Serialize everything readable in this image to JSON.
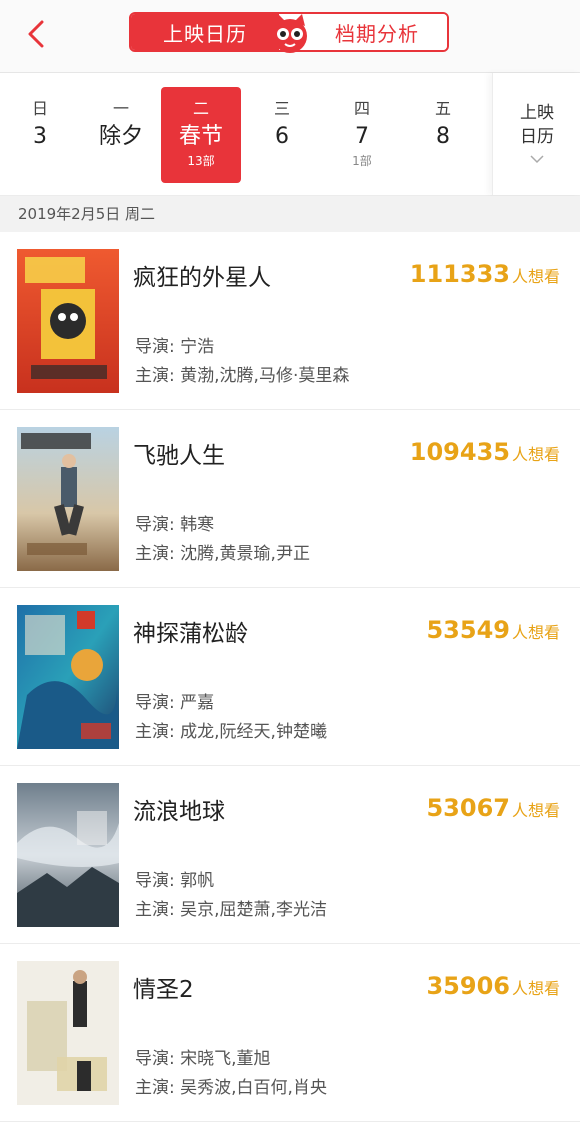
{
  "header": {
    "tab_calendar": "上映日历",
    "tab_analysis": "档期分析"
  },
  "days": [
    {
      "weekday": "日",
      "date": "3",
      "count": ""
    },
    {
      "weekday": "一",
      "date": "除夕",
      "count": ""
    },
    {
      "weekday": "二",
      "date": "春节",
      "count": "13部"
    },
    {
      "weekday": "三",
      "date": "6",
      "count": ""
    },
    {
      "weekday": "四",
      "date": "7",
      "count": "1部"
    },
    {
      "weekday": "五",
      "date": "8",
      "count": ""
    }
  ],
  "calendar_button": {
    "line1": "上映",
    "line2": "日历"
  },
  "date_header": "2019年2月5日 周二",
  "want_suffix": "人想看",
  "director_prefix": "导演: ",
  "cast_prefix": "主演: ",
  "movies": [
    {
      "title": "疯狂的外星人",
      "want_count": "111333",
      "director": "宁浩",
      "cast": "黄渤,沈腾,马修·莫里森"
    },
    {
      "title": "飞驰人生",
      "want_count": "109435",
      "director": "韩寒",
      "cast": "沈腾,黄景瑜,尹正"
    },
    {
      "title": "神探蒲松龄",
      "want_count": "53549",
      "director": "严嘉",
      "cast": "成龙,阮经天,钟楚曦"
    },
    {
      "title": "流浪地球",
      "want_count": "53067",
      "director": "郭帆",
      "cast": "吴京,屈楚萧,李光洁"
    },
    {
      "title": "情圣2",
      "want_count": "35906",
      "director": "宋晓飞,董旭",
      "cast": "吴秀波,白百何,肖央"
    }
  ],
  "colors": {
    "accent": "#e8343a",
    "want": "#e8a317"
  }
}
